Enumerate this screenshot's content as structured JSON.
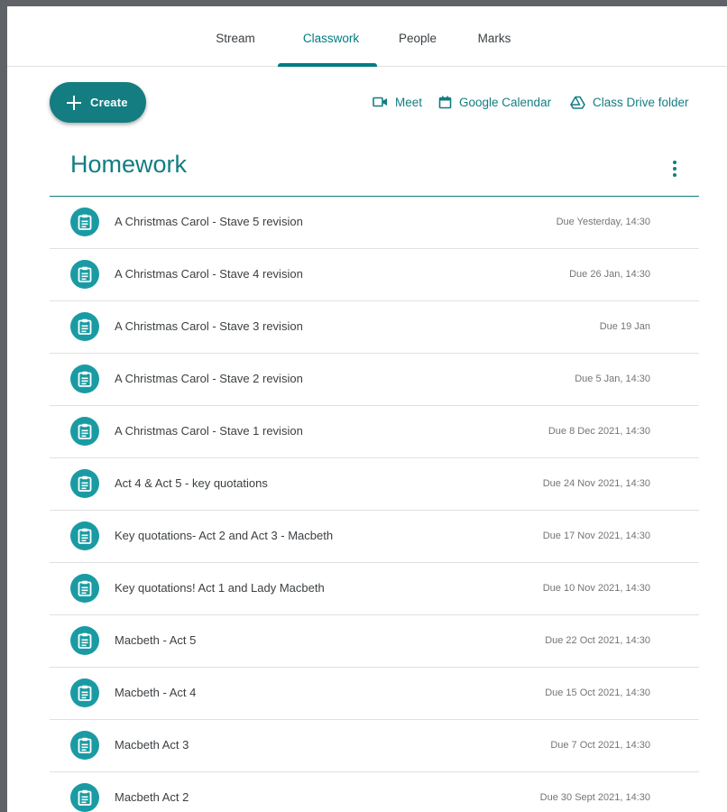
{
  "colors": {
    "accent": "#137d82",
    "badge": "#1a9ba3",
    "text": "#3c4043",
    "muted": "#757575"
  },
  "nav": {
    "tabs": [
      {
        "label": "Stream",
        "active": false
      },
      {
        "label": "Classwork",
        "active": true
      },
      {
        "label": "People",
        "active": false
      },
      {
        "label": "Marks",
        "active": false
      }
    ]
  },
  "toolbar": {
    "create_label": "Create",
    "meet_label": "Meet",
    "calendar_label": "Google Calendar",
    "drive_label": "Class Drive folder"
  },
  "topic": {
    "title": "Homework",
    "assignments": [
      {
        "title": "A Christmas Carol - Stave 5 revision",
        "due": "Due Yesterday, 14:30",
        "icon": "assignment-icon"
      },
      {
        "title": "A Christmas Carol - Stave 4 revision",
        "due": "Due 26 Jan, 14:30",
        "icon": "assignment-icon"
      },
      {
        "title": "A Christmas Carol - Stave 3 revision",
        "due": "Due 19 Jan",
        "icon": "assignment-icon"
      },
      {
        "title": "A Christmas Carol - Stave 2 revision",
        "due": "Due 5 Jan, 14:30",
        "icon": "assignment-icon"
      },
      {
        "title": "A Christmas Carol - Stave 1 revision",
        "due": "Due 8 Dec 2021, 14:30",
        "icon": "assignment-icon"
      },
      {
        "title": "Act 4 & Act 5 - key quotations",
        "due": "Due 24 Nov 2021, 14:30",
        "icon": "assignment-icon"
      },
      {
        "title": "Key quotations- Act 2 and Act 3 - Macbeth",
        "due": "Due 17 Nov 2021, 14:30",
        "icon": "assignment-icon"
      },
      {
        "title": "Key quotations! Act 1 and Lady Macbeth",
        "due": "Due 10 Nov 2021, 14:30",
        "icon": "assignment-icon"
      },
      {
        "title": "Macbeth - Act 5",
        "due": "Due 22 Oct 2021, 14:30",
        "icon": "assignment-icon"
      },
      {
        "title": "Macbeth - Act 4",
        "due": "Due 15 Oct 2021, 14:30",
        "icon": "assignment-icon"
      },
      {
        "title": "Macbeth Act 3",
        "due": "Due 7 Oct 2021, 14:30",
        "icon": "assignment-icon"
      },
      {
        "title": "Macbeth Act 2",
        "due": "Due 30 Sept 2021, 14:30",
        "icon": "assignment-icon"
      }
    ]
  }
}
